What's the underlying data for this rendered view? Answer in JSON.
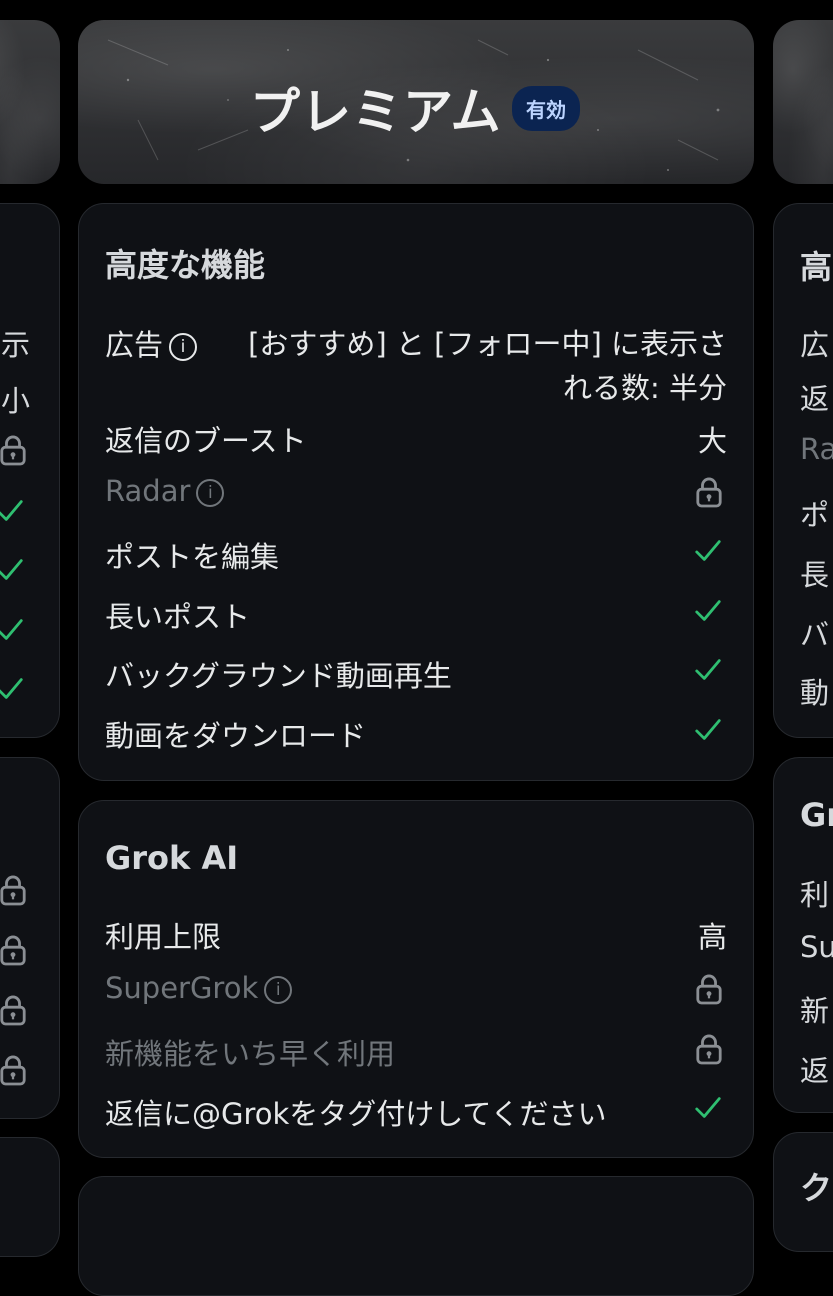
{
  "banner": {
    "title": "プレミアム",
    "badge": "有効"
  },
  "advanced": {
    "title": "高度な機能",
    "ads": {
      "label": "広告",
      "info": "i",
      "value": "[おすすめ] と [フォロー中] に表示される数: 半分"
    },
    "reply_boost": {
      "label": "返信のブースト",
      "value": "大"
    },
    "radar": {
      "label": "Radar",
      "info": "i"
    },
    "edit_post": {
      "label": "ポストを編集"
    },
    "long_post": {
      "label": "長いポスト"
    },
    "bg_video": {
      "label": "バックグラウンド動画再生"
    },
    "download_video": {
      "label": "動画をダウンロード"
    }
  },
  "grok": {
    "title": "Grok AI",
    "limit": {
      "label": "利用上限",
      "value": "高"
    },
    "supergrok": {
      "label": "SuperGrok",
      "info": "i"
    },
    "early_access": {
      "label": "新機能をいち早く利用"
    },
    "tag_grok": {
      "label": "返信に@Grokをタグ付けしてください"
    }
  },
  "left_partial": {
    "r1": "示",
    "r2": "小"
  },
  "right_partial": {
    "title": "高",
    "r1": "広",
    "r2": "返",
    "r3": "Ra",
    "r4": "ポ",
    "r5": "長",
    "r6": "バ",
    "r7": "動",
    "g_title": "Gr",
    "g1": "利",
    "g2": "Su",
    "g3": "新",
    "g4": "返",
    "bottom": "ク"
  },
  "colors": {
    "check": "#2fbf71",
    "lock": "#8b8f94",
    "badge_bg": "#0b2451"
  },
  "icons": [
    "info-icon",
    "lock-icon",
    "check-icon"
  ]
}
